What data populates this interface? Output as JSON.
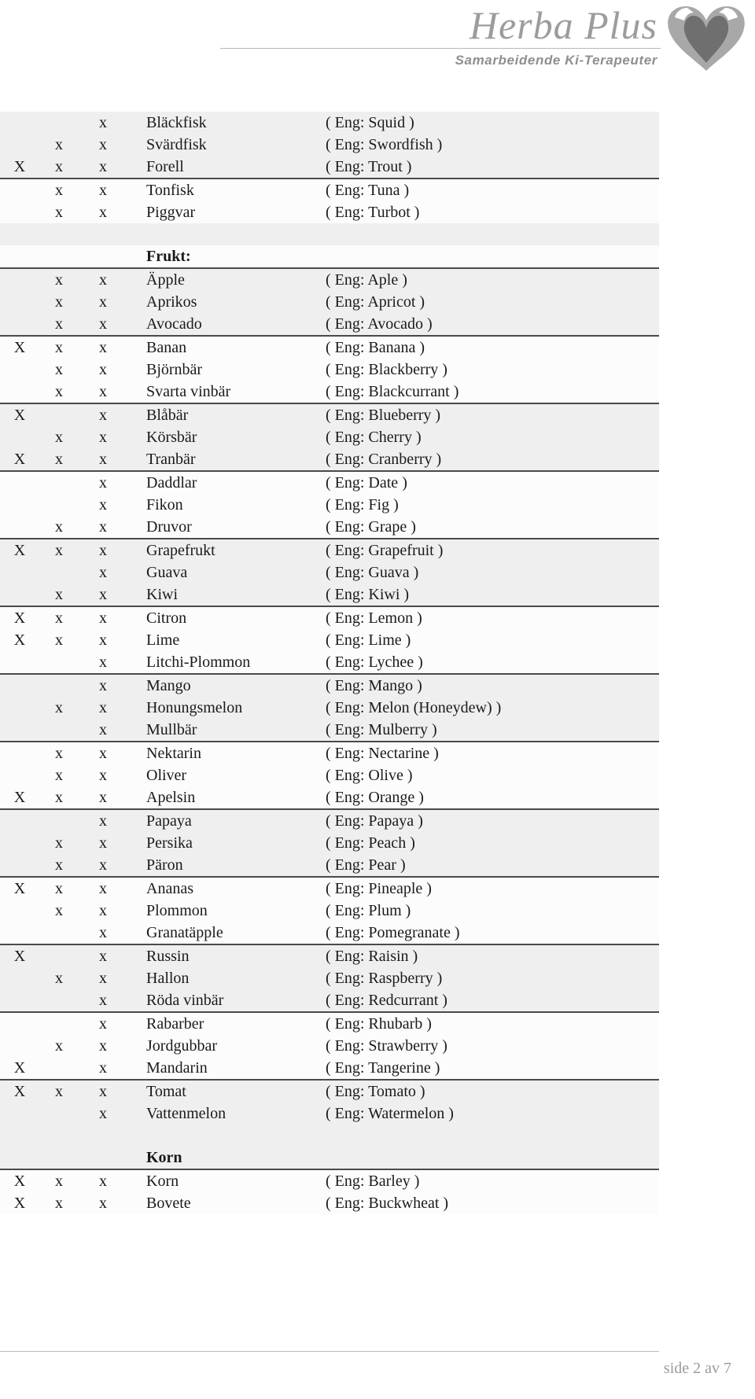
{
  "header": {
    "logo_text": "Herba Plus",
    "logo_tagline": "Samarbeidende Ki-Terapeuter",
    "logo_icon": "heart-icon"
  },
  "footer": {
    "page_label": "side 2 av 7"
  },
  "table": {
    "columns": [
      "mark1",
      "mark2",
      "mark3",
      "swedish_name",
      "english_name"
    ],
    "rows": [
      {
        "type": "item",
        "mark1": "",
        "mark2": "",
        "mark3": "x",
        "name": "Bläckfisk",
        "eng": "( Eng: Squid )"
      },
      {
        "type": "item",
        "mark1": "",
        "mark2": "x",
        "mark3": "x",
        "name": "Svärdfisk",
        "eng": "( Eng: Swordfish )"
      },
      {
        "type": "item",
        "mark1": "X",
        "mark2": "x",
        "mark3": "x",
        "name": "Forell",
        "eng": "( Eng: Trout )"
      },
      {
        "type": "item",
        "mark1": "",
        "mark2": "x",
        "mark3": "x",
        "name": "Tonfisk",
        "eng": "( Eng: Tuna )"
      },
      {
        "type": "item",
        "mark1": "",
        "mark2": "x",
        "mark3": "x",
        "name": "Piggvar",
        "eng": "( Eng: Turbot )"
      },
      {
        "type": "spacer"
      },
      {
        "type": "section",
        "name": "Frukt:"
      },
      {
        "type": "item",
        "mark1": "",
        "mark2": "x",
        "mark3": "x",
        "name": "Äpple",
        "eng": "( Eng: Aple )"
      },
      {
        "type": "item",
        "mark1": "",
        "mark2": "x",
        "mark3": "x",
        "name": "Aprikos",
        "eng": "( Eng: Apricot )"
      },
      {
        "type": "item",
        "mark1": "",
        "mark2": "x",
        "mark3": "x",
        "name": "Avocado",
        "eng": "( Eng: Avocado )"
      },
      {
        "type": "item",
        "mark1": "X",
        "mark2": "x",
        "mark3": "x",
        "name": "Banan",
        "eng": "( Eng: Banana )"
      },
      {
        "type": "item",
        "mark1": "",
        "mark2": "x",
        "mark3": "x",
        "name": "Björnbär",
        "eng": "( Eng: Blackberry )"
      },
      {
        "type": "item",
        "mark1": "",
        "mark2": "x",
        "mark3": "x",
        "name": "Svarta vinbär",
        "eng": "( Eng: Blackcurrant )"
      },
      {
        "type": "item",
        "mark1": "X",
        "mark2": "",
        "mark3": "x",
        "name": "Blåbär",
        "eng": "( Eng: Blueberry )"
      },
      {
        "type": "item",
        "mark1": "",
        "mark2": "x",
        "mark3": "x",
        "name": "Körsbär",
        "eng": "( Eng: Cherry )"
      },
      {
        "type": "item",
        "mark1": "X",
        "mark2": "x",
        "mark3": "x",
        "name": "Tranbär",
        "eng": "( Eng: Cranberry )"
      },
      {
        "type": "item",
        "mark1": "",
        "mark2": "",
        "mark3": "x",
        "name": "Daddlar",
        "eng": "( Eng: Date )"
      },
      {
        "type": "item",
        "mark1": "",
        "mark2": "",
        "mark3": "x",
        "name": "Fikon",
        "eng": "( Eng: Fig )"
      },
      {
        "type": "item",
        "mark1": "",
        "mark2": "x",
        "mark3": "x",
        "name": "Druvor",
        "eng": "( Eng: Grape )"
      },
      {
        "type": "item",
        "mark1": "X",
        "mark2": "x",
        "mark3": "x",
        "name": "Grapefrukt",
        "eng": "( Eng: Grapefruit )"
      },
      {
        "type": "item",
        "mark1": "",
        "mark2": "",
        "mark3": "x",
        "name": "Guava",
        "eng": "( Eng: Guava )"
      },
      {
        "type": "item",
        "mark1": "",
        "mark2": "x",
        "mark3": "x",
        "name": "Kiwi",
        "eng": "( Eng: Kiwi )"
      },
      {
        "type": "item",
        "mark1": "X",
        "mark2": "x",
        "mark3": "x",
        "name": "Citron",
        "eng": "( Eng: Lemon )"
      },
      {
        "type": "item",
        "mark1": "X",
        "mark2": "x",
        "mark3": "x",
        "name": "Lime",
        "eng": "( Eng: Lime )"
      },
      {
        "type": "item",
        "mark1": "",
        "mark2": "",
        "mark3": "x",
        "name": "Litchi-Plommon",
        "eng": "( Eng: Lychee )"
      },
      {
        "type": "item",
        "mark1": "",
        "mark2": "",
        "mark3": "x",
        "name": "Mango",
        "eng": "( Eng: Mango )"
      },
      {
        "type": "item",
        "mark1": "",
        "mark2": "x",
        "mark3": "x",
        "name": "Honungsmelon",
        "eng": "( Eng: Melon (Honeydew) )"
      },
      {
        "type": "item",
        "mark1": "",
        "mark2": "",
        "mark3": "x",
        "name": "Mullbär",
        "eng": "( Eng: Mulberry )"
      },
      {
        "type": "item",
        "mark1": "",
        "mark2": "x",
        "mark3": "x",
        "name": "Nektarin",
        "eng": "( Eng: Nectarine )"
      },
      {
        "type": "item",
        "mark1": "",
        "mark2": "x",
        "mark3": "x",
        "name": "Oliver",
        "eng": "( Eng: Olive )"
      },
      {
        "type": "item",
        "mark1": "X",
        "mark2": "x",
        "mark3": "x",
        "name": "Apelsin",
        "eng": "( Eng: Orange )"
      },
      {
        "type": "item",
        "mark1": "",
        "mark2": "",
        "mark3": "x",
        "name": "Papaya",
        "eng": "( Eng: Papaya )"
      },
      {
        "type": "item",
        "mark1": "",
        "mark2": "x",
        "mark3": "x",
        "name": "Persika",
        "eng": "( Eng: Peach )"
      },
      {
        "type": "item",
        "mark1": "",
        "mark2": "x",
        "mark3": "x",
        "name": "Päron",
        "eng": "( Eng: Pear )"
      },
      {
        "type": "item",
        "mark1": "X",
        "mark2": "x",
        "mark3": "x",
        "name": "Ananas",
        "eng": "( Eng: Pineaple )"
      },
      {
        "type": "item",
        "mark1": "",
        "mark2": "x",
        "mark3": "x",
        "name": "Plommon",
        "eng": "( Eng: Plum )"
      },
      {
        "type": "item",
        "mark1": "",
        "mark2": "",
        "mark3": "x",
        "name": "Granatäpple",
        "eng": "( Eng: Pomegranate )"
      },
      {
        "type": "item",
        "mark1": "X",
        "mark2": "",
        "mark3": "x",
        "name": "Russin",
        "eng": "( Eng: Raisin )"
      },
      {
        "type": "item",
        "mark1": "",
        "mark2": "x",
        "mark3": "x",
        "name": "Hallon",
        "eng": "( Eng: Raspberry )"
      },
      {
        "type": "item",
        "mark1": "",
        "mark2": "",
        "mark3": "x",
        "name": "Röda vinbär",
        "eng": "( Eng: Redcurrant )"
      },
      {
        "type": "item",
        "mark1": "",
        "mark2": "",
        "mark3": "x",
        "name": "Rabarber",
        "eng": "( Eng: Rhubarb )"
      },
      {
        "type": "item",
        "mark1": "",
        "mark2": "x",
        "mark3": "x",
        "name": "Jordgubbar",
        "eng": "( Eng: Strawberry )"
      },
      {
        "type": "item",
        "mark1": "X",
        "mark2": "",
        "mark3": "x",
        "name": "Mandarin",
        "eng": "( Eng: Tangerine )"
      },
      {
        "type": "item",
        "mark1": "X",
        "mark2": "x",
        "mark3": "x",
        "name": "Tomat",
        "eng": "( Eng: Tomato )"
      },
      {
        "type": "item",
        "mark1": "",
        "mark2": "",
        "mark3": "x",
        "name": "Vattenmelon",
        "eng": "( Eng: Watermelon )"
      },
      {
        "type": "spacer-tall"
      },
      {
        "type": "section",
        "name": "Korn"
      },
      {
        "type": "item",
        "mark1": "X",
        "mark2": "x",
        "mark3": "x",
        "name": "Korn",
        "eng": "( Eng: Barley )"
      },
      {
        "type": "item",
        "mark1": "X",
        "mark2": "x",
        "mark3": "x",
        "name": "Bovete",
        "eng": "( Eng: Buckwheat )"
      }
    ]
  },
  "colors": {
    "logo_gray": "#9c9c9c",
    "translation_gray": "#a0a0a0",
    "row_shade": "#efefef",
    "row_plain": "#fcfcfc",
    "rule_dark": "#4a4a4a"
  }
}
